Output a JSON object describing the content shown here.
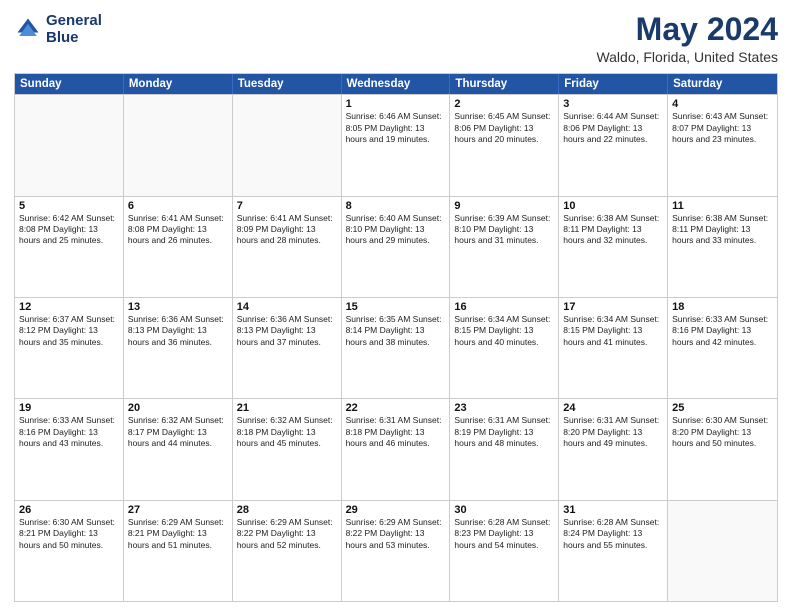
{
  "logo": {
    "line1": "General",
    "line2": "Blue"
  },
  "title": "May 2024",
  "subtitle": "Waldo, Florida, United States",
  "header_days": [
    "Sunday",
    "Monday",
    "Tuesday",
    "Wednesday",
    "Thursday",
    "Friday",
    "Saturday"
  ],
  "weeks": [
    [
      {
        "day": "",
        "detail": ""
      },
      {
        "day": "",
        "detail": ""
      },
      {
        "day": "",
        "detail": ""
      },
      {
        "day": "1",
        "detail": "Sunrise: 6:46 AM\nSunset: 8:05 PM\nDaylight: 13 hours\nand 19 minutes."
      },
      {
        "day": "2",
        "detail": "Sunrise: 6:45 AM\nSunset: 8:06 PM\nDaylight: 13 hours\nand 20 minutes."
      },
      {
        "day": "3",
        "detail": "Sunrise: 6:44 AM\nSunset: 8:06 PM\nDaylight: 13 hours\nand 22 minutes."
      },
      {
        "day": "4",
        "detail": "Sunrise: 6:43 AM\nSunset: 8:07 PM\nDaylight: 13 hours\nand 23 minutes."
      }
    ],
    [
      {
        "day": "5",
        "detail": "Sunrise: 6:42 AM\nSunset: 8:08 PM\nDaylight: 13 hours\nand 25 minutes."
      },
      {
        "day": "6",
        "detail": "Sunrise: 6:41 AM\nSunset: 8:08 PM\nDaylight: 13 hours\nand 26 minutes."
      },
      {
        "day": "7",
        "detail": "Sunrise: 6:41 AM\nSunset: 8:09 PM\nDaylight: 13 hours\nand 28 minutes."
      },
      {
        "day": "8",
        "detail": "Sunrise: 6:40 AM\nSunset: 8:10 PM\nDaylight: 13 hours\nand 29 minutes."
      },
      {
        "day": "9",
        "detail": "Sunrise: 6:39 AM\nSunset: 8:10 PM\nDaylight: 13 hours\nand 31 minutes."
      },
      {
        "day": "10",
        "detail": "Sunrise: 6:38 AM\nSunset: 8:11 PM\nDaylight: 13 hours\nand 32 minutes."
      },
      {
        "day": "11",
        "detail": "Sunrise: 6:38 AM\nSunset: 8:11 PM\nDaylight: 13 hours\nand 33 minutes."
      }
    ],
    [
      {
        "day": "12",
        "detail": "Sunrise: 6:37 AM\nSunset: 8:12 PM\nDaylight: 13 hours\nand 35 minutes."
      },
      {
        "day": "13",
        "detail": "Sunrise: 6:36 AM\nSunset: 8:13 PM\nDaylight: 13 hours\nand 36 minutes."
      },
      {
        "day": "14",
        "detail": "Sunrise: 6:36 AM\nSunset: 8:13 PM\nDaylight: 13 hours\nand 37 minutes."
      },
      {
        "day": "15",
        "detail": "Sunrise: 6:35 AM\nSunset: 8:14 PM\nDaylight: 13 hours\nand 38 minutes."
      },
      {
        "day": "16",
        "detail": "Sunrise: 6:34 AM\nSunset: 8:15 PM\nDaylight: 13 hours\nand 40 minutes."
      },
      {
        "day": "17",
        "detail": "Sunrise: 6:34 AM\nSunset: 8:15 PM\nDaylight: 13 hours\nand 41 minutes."
      },
      {
        "day": "18",
        "detail": "Sunrise: 6:33 AM\nSunset: 8:16 PM\nDaylight: 13 hours\nand 42 minutes."
      }
    ],
    [
      {
        "day": "19",
        "detail": "Sunrise: 6:33 AM\nSunset: 8:16 PM\nDaylight: 13 hours\nand 43 minutes."
      },
      {
        "day": "20",
        "detail": "Sunrise: 6:32 AM\nSunset: 8:17 PM\nDaylight: 13 hours\nand 44 minutes."
      },
      {
        "day": "21",
        "detail": "Sunrise: 6:32 AM\nSunset: 8:18 PM\nDaylight: 13 hours\nand 45 minutes."
      },
      {
        "day": "22",
        "detail": "Sunrise: 6:31 AM\nSunset: 8:18 PM\nDaylight: 13 hours\nand 46 minutes."
      },
      {
        "day": "23",
        "detail": "Sunrise: 6:31 AM\nSunset: 8:19 PM\nDaylight: 13 hours\nand 48 minutes."
      },
      {
        "day": "24",
        "detail": "Sunrise: 6:31 AM\nSunset: 8:20 PM\nDaylight: 13 hours\nand 49 minutes."
      },
      {
        "day": "25",
        "detail": "Sunrise: 6:30 AM\nSunset: 8:20 PM\nDaylight: 13 hours\nand 50 minutes."
      }
    ],
    [
      {
        "day": "26",
        "detail": "Sunrise: 6:30 AM\nSunset: 8:21 PM\nDaylight: 13 hours\nand 50 minutes."
      },
      {
        "day": "27",
        "detail": "Sunrise: 6:29 AM\nSunset: 8:21 PM\nDaylight: 13 hours\nand 51 minutes."
      },
      {
        "day": "28",
        "detail": "Sunrise: 6:29 AM\nSunset: 8:22 PM\nDaylight: 13 hours\nand 52 minutes."
      },
      {
        "day": "29",
        "detail": "Sunrise: 6:29 AM\nSunset: 8:22 PM\nDaylight: 13 hours\nand 53 minutes."
      },
      {
        "day": "30",
        "detail": "Sunrise: 6:28 AM\nSunset: 8:23 PM\nDaylight: 13 hours\nand 54 minutes."
      },
      {
        "day": "31",
        "detail": "Sunrise: 6:28 AM\nSunset: 8:24 PM\nDaylight: 13 hours\nand 55 minutes."
      },
      {
        "day": "",
        "detail": ""
      }
    ]
  ]
}
